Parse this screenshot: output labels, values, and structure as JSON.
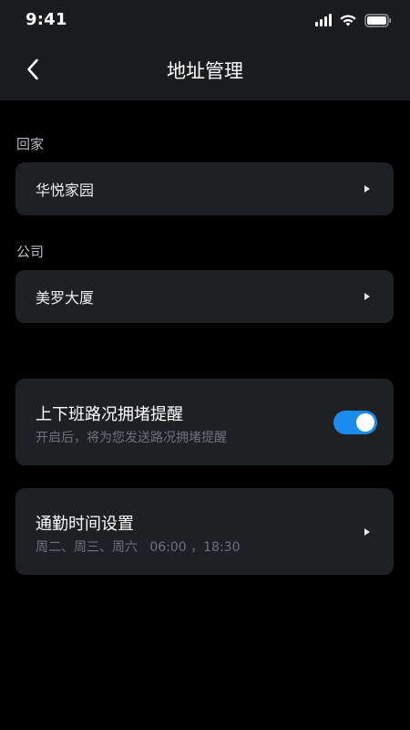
{
  "status_bar": {
    "time": "9:41",
    "icons": [
      "signal-icon",
      "wifi-icon",
      "battery-icon"
    ]
  },
  "header": {
    "back_icon": "chevron-left-icon",
    "title": "地址管理"
  },
  "addresses": {
    "home": {
      "label": "回家",
      "value": "华悦家园"
    },
    "company": {
      "label": "公司",
      "value": "美罗大厦"
    }
  },
  "congestion_reminder": {
    "title": "上下班路况拥堵提醒",
    "subtitle": "开启后，将为您发送路况拥堵提醒",
    "enabled": true
  },
  "commute_time": {
    "title": "通勤时间设置",
    "subtitle": "周二、周三、周六   06:00 ，18:30"
  },
  "colors": {
    "background": "#000000",
    "header_bg": "#1b1c1f",
    "card_bg": "#1e2024",
    "toggle_on": "#1a8cf0",
    "muted_text": "#6f7278"
  }
}
